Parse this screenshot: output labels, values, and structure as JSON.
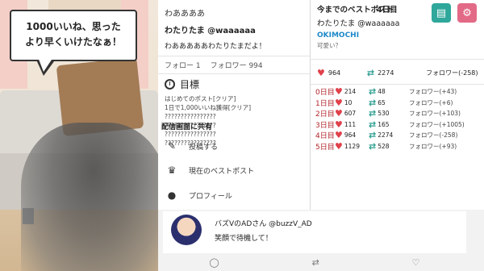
{
  "speech_bubble": {
    "line1": "1000いいね、思った",
    "line2": "より早くいけたなぁ！"
  },
  "profile": {
    "display_name": "わああああ",
    "user": "わたりたま @waaaaaa",
    "bio": "わあああああわたりたまだよ！",
    "following": "フォロー 1",
    "followers": "フォロワー 994",
    "goals_title": "目標",
    "goals": [
      "はじめてのポスト[クリア]",
      "1日で1,000いいね獲得[クリア]",
      "????????????????",
      "????????????????",
      "????????????????",
      "????????????????"
    ],
    "share_title": "配信画面に共有",
    "menu": {
      "post": "投稿する",
      "best": "現在のベストポスト",
      "profile": "プロフィール"
    }
  },
  "best_post": {
    "title": "今までのベストポスト",
    "day": "4日目",
    "user": "わたりたま @waaaaaa",
    "mention": "OKIMOCHI",
    "text": "可愛い？",
    "likes": "964",
    "reposts": "2274",
    "followers": "フォロワー(-258)",
    "rows": [
      {
        "day": "0日目",
        "likes": "214",
        "reposts": "48",
        "followers": "フォロワー(+43)"
      },
      {
        "day": "1日目",
        "likes": "10",
        "reposts": "65",
        "followers": "フォロワー(+6)"
      },
      {
        "day": "2日目",
        "likes": "607",
        "reposts": "530",
        "followers": "フォロワー(+103)"
      },
      {
        "day": "3日目",
        "likes": "111",
        "reposts": "165",
        "followers": "フォロワー(+1005)"
      },
      {
        "day": "4日目",
        "likes": "964",
        "reposts": "2274",
        "followers": "フォロワー(-258)"
      },
      {
        "day": "5日目",
        "likes": "1129",
        "reposts": "528",
        "followers": "フォロワー(+93)"
      }
    ]
  },
  "post": {
    "author": "バズVのADさん @buzzV_AD",
    "text": "笑顔で待機して！"
  },
  "colors": {
    "accent_red": "#e0414b",
    "repost_green": "#2a9d8f",
    "book_button": "#2fa79b",
    "settings_button": "#e26a86"
  }
}
